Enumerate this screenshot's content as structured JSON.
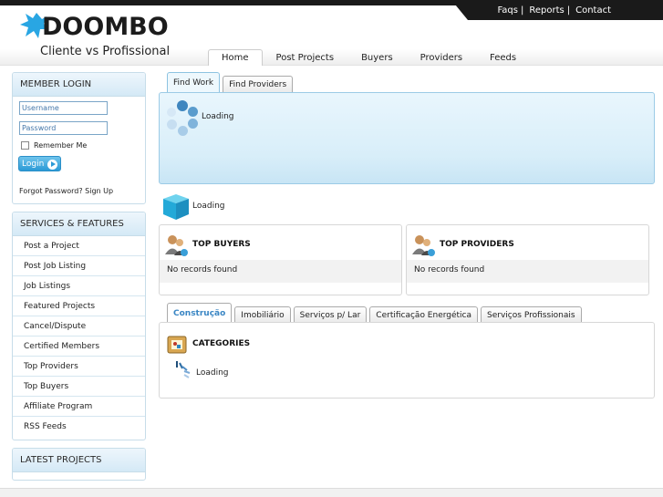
{
  "header": {
    "top_links": [
      "Faqs",
      "Reports",
      "Contact"
    ],
    "top_link_separator": "|",
    "logo_word": "DOOMBO",
    "logo_subtitle": "Cliente vs Profissional",
    "nav": [
      {
        "label": "Home",
        "active": true
      },
      {
        "label": "Post Projects",
        "active": false
      },
      {
        "label": "Buyers",
        "active": false
      },
      {
        "label": "Providers",
        "active": false
      },
      {
        "label": "Feeds",
        "active": false
      }
    ]
  },
  "login": {
    "heading": "MEMBER LOGIN",
    "username_placeholder": "Username",
    "password_placeholder": "Password",
    "remember_label": "Remember Me",
    "button_label": "Login",
    "forgot_label": "Forgot Password?",
    "signup_label": "Sign Up"
  },
  "services": {
    "heading": "SERVICES & FEATURES",
    "items": [
      "Post a Project",
      "Post Job Listing",
      "Job Listings",
      "Featured Projects",
      "Cancel/Dispute",
      "Certified Members",
      "Top Providers",
      "Top Buyers",
      "Affiliate Program",
      "RSS Feeds"
    ]
  },
  "latest": {
    "heading": "LATEST PROJECTS"
  },
  "main": {
    "top_tabs": [
      {
        "label": "Find Work",
        "active": true
      },
      {
        "label": "Find Providers",
        "active": false
      }
    ],
    "loading_label": "Loading",
    "cube_loading_label": "Loading",
    "top_buyers": {
      "title": "TOP BUYERS",
      "empty": "No records found"
    },
    "top_providers": {
      "title": "TOP PROVIDERS",
      "empty": "No records found"
    },
    "category_tabs": [
      {
        "label": "Construção",
        "active": true
      },
      {
        "label": "Imobiliário",
        "active": false
      },
      {
        "label": "Serviços p/ Lar",
        "active": false
      },
      {
        "label": "Certificação Energética",
        "active": false
      },
      {
        "label": "Serviços Profissionais",
        "active": false
      }
    ],
    "categories": {
      "title": "CATEGORIES",
      "loading": "Loading"
    }
  },
  "colors": {
    "accent": "#2b9ad6",
    "panel_blue": "#d8eef9",
    "header_dark": "#1a1a1a"
  }
}
